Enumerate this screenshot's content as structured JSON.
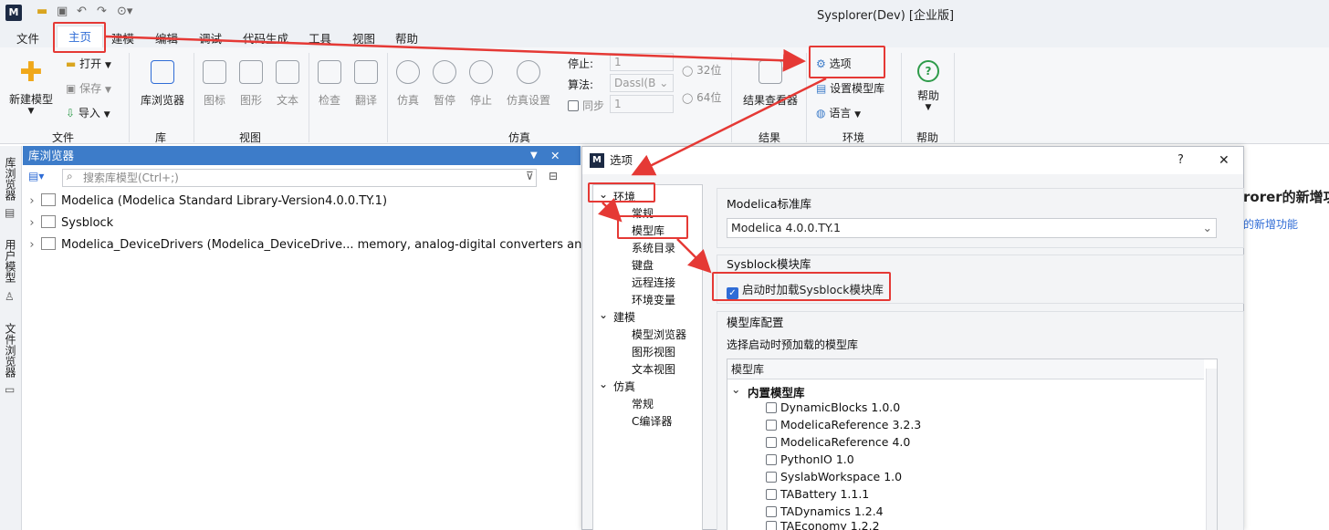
{
  "title": {
    "window": "Sysplorer(Dev) [企业版]",
    "logo": "M"
  },
  "quick_access": [
    "folder-icon",
    "save-icon",
    "undo-icon",
    "redo-icon",
    "play-icon"
  ],
  "menu": [
    "文件",
    "主页",
    "建模",
    "编辑",
    "调试",
    "代码生成",
    "工具",
    "视图",
    "帮助"
  ],
  "ribbon": {
    "file": {
      "new_model": "新建模型",
      "open": "打开",
      "save": "保存",
      "import": "导入",
      "group": "文件"
    },
    "library": {
      "browser": "库浏览器",
      "group": "库"
    },
    "view": {
      "icon": "图标",
      "diagram": "图形",
      "text": "文本",
      "group": "视图"
    },
    "sim": {
      "check": "检查",
      "translate": "翻译",
      "simulate": "仿真",
      "pause": "暂停",
      "stop": "停止",
      "settings": "仿真设置",
      "stop_label": "停止:",
      "stop_value": "1",
      "algo_label": "算法:",
      "algo_value": "Dassl(B",
      "sync_label": "同步",
      "sync_value": "1",
      "bit32": "32位",
      "bit64": "64位",
      "group": "仿真"
    },
    "result": {
      "viewer": "结果查看器",
      "group": "结果"
    },
    "env": {
      "options": "选项",
      "set_lib": "设置模型库",
      "language": "语言",
      "group": "环境"
    },
    "help": {
      "help": "帮助",
      "group": "帮助",
      "icon_text": "?"
    }
  },
  "side_tabs": [
    "库浏览器",
    "用户模型",
    "文件浏览器"
  ],
  "lib": {
    "title": "库浏览器",
    "search_placeholder": "搜索库模型(Ctrl+;)",
    "items": [
      "Modelica (Modelica Standard Library-Version4.0.0.TY.1)",
      "Sysblock",
      "Modelica_DeviceDrivers (Modelica_DeviceDrive... memory, analog-digital converters and else)"
    ]
  },
  "right_partial": {
    "heading": "rorer的新增功",
    "link": "的新增功能"
  },
  "dialog": {
    "title": "选项",
    "help": "?",
    "close": "✕",
    "nav": {
      "env": "环境",
      "env_items": [
        "常规",
        "模型库",
        "系统目录",
        "键盘",
        "远程连接",
        "环境变量"
      ],
      "model": "建模",
      "model_items": [
        "模型浏览器",
        "图形视图",
        "文本视图"
      ],
      "sim": "仿真",
      "sim_items": [
        "常规",
        "C编译器"
      ]
    },
    "std_lib_title": "Modelica标准库",
    "std_lib_value": "Modelica 4.0.0.TY.1",
    "sysblock_title": "Sysblock模块库",
    "sysblock_check": "启动时加载Sysblock模块库",
    "libcfg_title": "模型库配置",
    "libcfg_desc": "选择启动时预加载的模型库",
    "list_header": "模型库",
    "builtin": "内置模型库",
    "libs": [
      "DynamicBlocks 1.0.0",
      "ModelicaReference 3.2.3",
      "ModelicaReference 4.0",
      "PythonIO 1.0",
      "SyslabWorkspace 1.0",
      "TABattery 1.1.1",
      "TADynamics 1.2.4",
      "TAEconomy 1.2.2"
    ]
  },
  "colors": {
    "accent": "#2f6cd6",
    "highlight": "#e53935",
    "panel_header": "#3d7cc9"
  }
}
